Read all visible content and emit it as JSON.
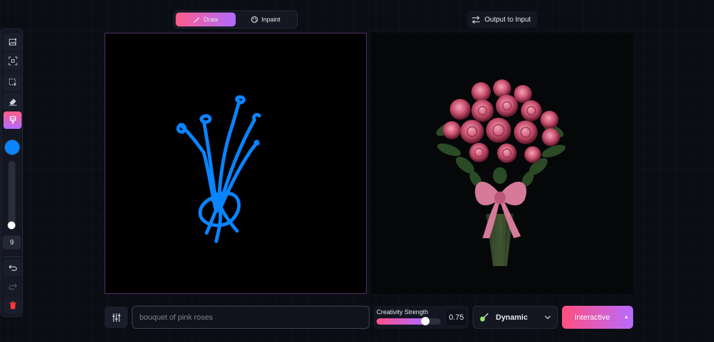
{
  "modes": {
    "draw_label": "Draw",
    "inpaint_label": "Inpaint",
    "active": "Draw"
  },
  "output_to_input_label": "Output to Input",
  "toolbar": {
    "brush_size": "9",
    "brush_color": "#0a84ff",
    "tools": [
      "image-add-icon",
      "focus-icon",
      "select-icon",
      "eraser-icon",
      "brush-icon",
      "undo-icon",
      "redo-icon",
      "trash-icon"
    ],
    "active_tool": "brush-icon"
  },
  "prompt": {
    "placeholder": "bouquet of pink roses"
  },
  "creativity": {
    "label": "Creativity Strength",
    "value": "0.75"
  },
  "style": {
    "selected": "Dynamic"
  },
  "generate": {
    "label": "Interactive"
  },
  "colors": {
    "accent_start": "#ff4f7f",
    "accent_end": "#b86bff"
  }
}
